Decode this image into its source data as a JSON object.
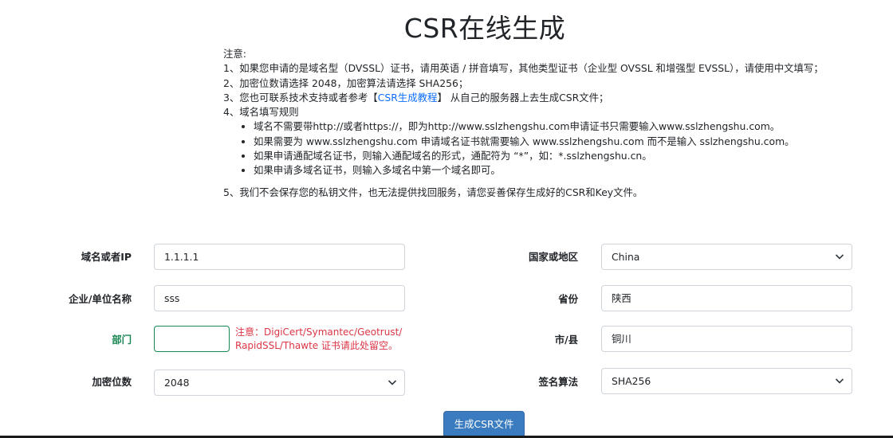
{
  "page": {
    "title": "CSR在线生成"
  },
  "notes": {
    "heading": "注意:",
    "item1": "1、如果您申请的是域名型（DVSSL）证书，请用英语 / 拼音填写，其他类型证书（企业型 OVSSL 和增强型 EVSSL），请使用中文填写；",
    "item2": "2、加密位数请选择 2048，加密算法请选择 SHA256；",
    "item3_prefix": "3、您也可联系技术支持或者参考【",
    "item3_link": "CSR生成教程",
    "item3_suffix": "】 从自己的服务器上去生成CSR文件；",
    "item4": "4、域名填写规则",
    "rules": [
      "域名不需要带http://或者https://，即为http://www.sslzhengshu.com申请证书只需要输入www.sslzhengshu.com。",
      "如果需要为 www.sslzhengshu.com 申请域名证书就需要输入 www.sslzhengshu.com 而不是输入 sslzhengshu.com。",
      "如果申请通配域名证书，则输入通配域名的形式，通配符为 “*”，如：*.sslzhengshu.cn。",
      "如果申请多域名证书，则输入多域名中第一个域名即可。"
    ],
    "item5": "5、我们不会保存您的私钥文件，也无法提供找回服务，请您妥善保存生成好的CSR和Key文件。"
  },
  "form": {
    "domain": {
      "label": "域名或者IP",
      "value": "1.1.1.1"
    },
    "organization": {
      "label": "企业/单位名称",
      "value": "sss"
    },
    "department": {
      "label": "部门",
      "value": "",
      "hint_line1": "注意：DigiCert/Symantec/Geotrust/",
      "hint_line2": "RapidSSL/Thawte 证书请此处留空。"
    },
    "key_size": {
      "label": "加密位数",
      "value": "2048"
    },
    "country": {
      "label": "国家或地区",
      "value": "China"
    },
    "province": {
      "label": "省份",
      "value": "陕西"
    },
    "city": {
      "label": "市/县",
      "value": "铜川"
    },
    "signature": {
      "label": "签名算法",
      "value": "SHA256"
    },
    "submit_label": "生成CSR文件"
  },
  "colors": {
    "link": "#0d6efd",
    "label_valid": "#198754",
    "hint_error": "#dc3545",
    "button": "#3b7bbf"
  },
  "icons": {
    "select_arrow": "chevron-down-icon"
  }
}
